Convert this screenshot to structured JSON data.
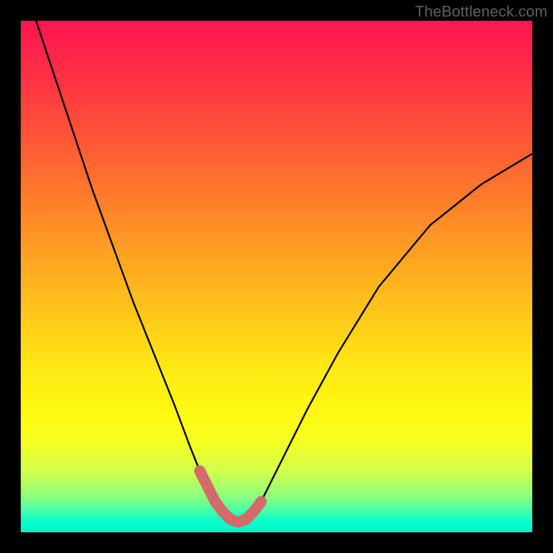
{
  "watermark": "TheBottleneck.com",
  "chart_data": {
    "type": "line",
    "title": "",
    "xlabel": "",
    "ylabel": "",
    "xlim": [
      0,
      100
    ],
    "ylim": [
      0,
      100
    ],
    "series": [
      {
        "name": "bottleneck-curve",
        "x": [
          3,
          6,
          10,
          14,
          18,
          22,
          26,
          30,
          33,
          35,
          36.5,
          38,
          39.5,
          41,
          42.5,
          44,
          45.5,
          47,
          49,
          52,
          56,
          62,
          70,
          80,
          90,
          100
        ],
        "values": [
          100,
          91,
          79,
          67,
          56,
          45,
          35,
          25,
          17,
          12,
          9,
          6,
          4,
          2.5,
          2,
          2.5,
          4,
          6,
          10,
          16,
          24,
          35,
          48,
          60,
          68,
          74
        ]
      }
    ],
    "highlight": {
      "name": "optimal-zone",
      "color": "#d46a6a",
      "indices_from": 9,
      "indices_to": 17
    }
  }
}
